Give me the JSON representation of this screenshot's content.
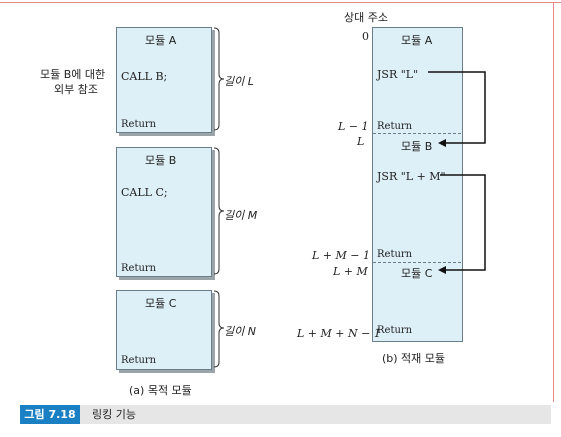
{
  "left": {
    "external_ref": [
      "모듈 B에 대한",
      "외부 참조"
    ],
    "module_a": {
      "title": "모듈 A",
      "call": "CALL B;",
      "ret": "Return",
      "length": "길이 L"
    },
    "module_b": {
      "title": "모듈 B",
      "call": "CALL C;",
      "ret": "Return",
      "length": "길이 M"
    },
    "module_c": {
      "title": "모듈 C",
      "ret": "Return",
      "length": "길이 N"
    },
    "caption": "(a) 목적 모듈"
  },
  "right": {
    "header": "상대 주소",
    "addresses": {
      "zero": "0",
      "l_minus_1": "L − 1",
      "l": "L",
      "lm_minus_1": "L + M − 1",
      "lm": "L + M",
      "lmn_minus_1": "L + M + N − 1"
    },
    "module_a_title": "모듈 A",
    "jsr_l": "JSR \"L\"",
    "ret_a": "Return",
    "module_b_title": "모듈 B",
    "jsr_lm": "JSR \"L + M\"",
    "ret_b": "Return",
    "module_c_title": "모듈 C",
    "ret_c": "Return",
    "caption": "(b) 적재 모듈"
  },
  "figure": {
    "tag": "그림 7.18",
    "title": "링킹 기능"
  },
  "colors": {
    "block_fill": "#ddeff7",
    "block_border": "#6a7e8a",
    "tag_blue": "#1b7fc4",
    "frame_pink": "#e48a86"
  }
}
